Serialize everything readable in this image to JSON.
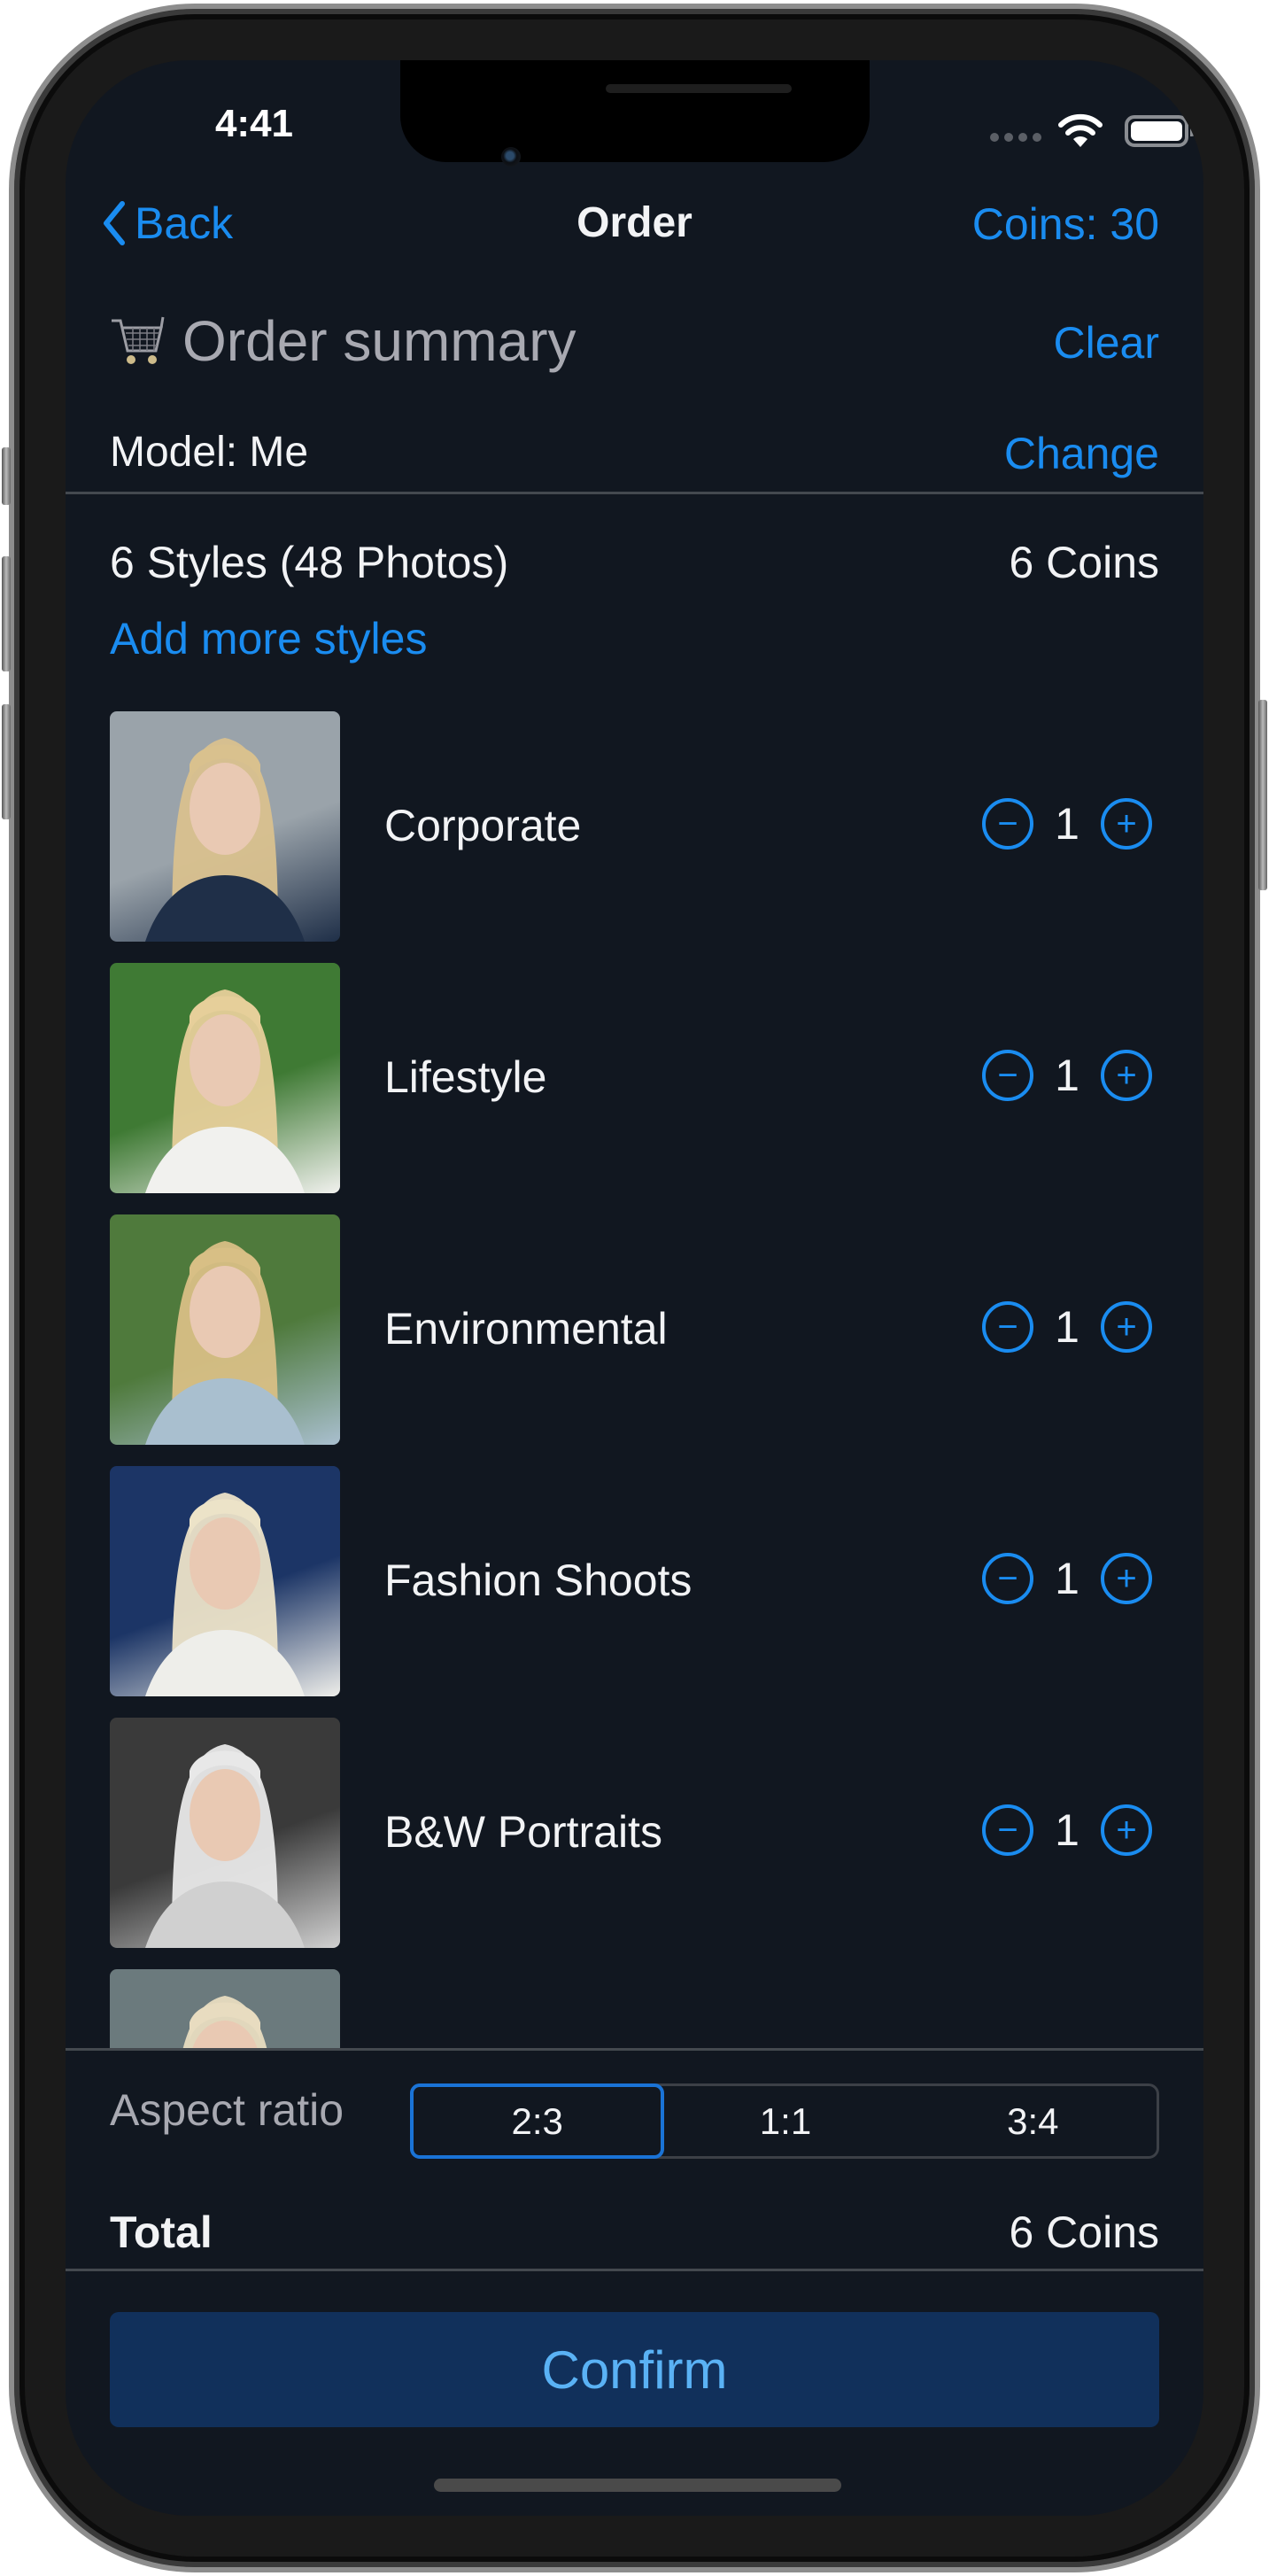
{
  "status_bar": {
    "time": "4:41",
    "signal_icon": "cellular-dots-icon",
    "wifi_icon": "wifi-icon",
    "battery_icon": "battery-icon"
  },
  "nav": {
    "back_label": "Back",
    "title": "Order",
    "coins_label": "Coins: 30",
    "back_icon": "chevron-left-icon"
  },
  "summary": {
    "icon": "shopping-cart-icon",
    "title": "Order summary",
    "clear_label": "Clear",
    "model_label": "Model: Me",
    "change_label": "Change",
    "styles_count": "6 Styles (48 Photos)",
    "styles_coins": "6 Coins",
    "add_more_label": "Add more styles"
  },
  "styles": [
    {
      "name": "Corporate",
      "quantity": "1",
      "thumb_palette": [
        "#9aa3aa",
        "#1f2f48",
        "#d9c18e"
      ]
    },
    {
      "name": "Lifestyle",
      "quantity": "1",
      "thumb_palette": [
        "#3f7a34",
        "#f1f1ee",
        "#e6cf9a"
      ]
    },
    {
      "name": "Environmental",
      "quantity": "1",
      "thumb_palette": [
        "#4f7a3c",
        "#a9bfcf",
        "#d8bf85"
      ]
    },
    {
      "name": "Fashion Shoots",
      "quantity": "1",
      "thumb_palette": [
        "#1c3566",
        "#eeeeea",
        "#ece3c8"
      ]
    },
    {
      "name": "B&W Portraits",
      "quantity": "1",
      "thumb_palette": [
        "#3a3a3a",
        "#d0d0d0",
        "#e8e8e8"
      ]
    },
    {
      "name": "",
      "quantity": "",
      "thumb_palette": [
        "#6b7a7d",
        "#a8b2b3",
        "#e8dcc0"
      ]
    }
  ],
  "stepper": {
    "minus_symbol": "−",
    "plus_symbol": "+"
  },
  "aspect_ratio": {
    "label": "Aspect ratio",
    "options": [
      "2:3",
      "1:1",
      "3:4"
    ],
    "selected": "2:3"
  },
  "total": {
    "label": "Total",
    "value": "6 Coins"
  },
  "confirm_label": "Confirm",
  "colors": {
    "accent": "#1a8cf0",
    "background": "#111720",
    "confirm_bg": "#11305b",
    "confirm_text": "#5ab2f5"
  }
}
